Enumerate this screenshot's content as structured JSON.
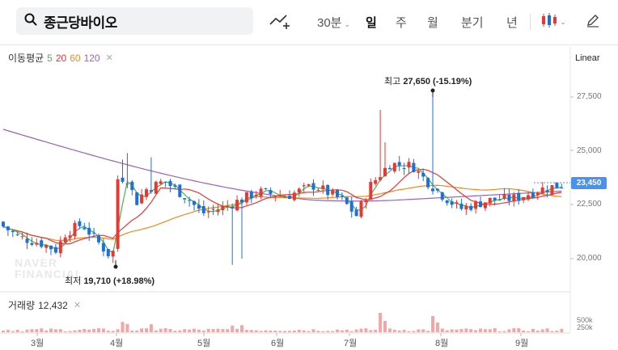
{
  "search": {
    "title": "종근당바이오"
  },
  "toolbar": {
    "interval_label": "30분",
    "periods": [
      "일",
      "주",
      "월",
      "분기",
      "년"
    ],
    "active_period": "일"
  },
  "ma_legend": {
    "label": "이동평균",
    "ma5": "5",
    "ma20": "20",
    "ma60": "60",
    "ma120": "120"
  },
  "scale_label": "Linear",
  "price_axis": [
    "27,500",
    "25,000",
    "22,500",
    "20,000"
  ],
  "current_price": "23,450",
  "high_annotation": {
    "label": "최고",
    "value": "27,650",
    "change": "(-15.19%)"
  },
  "low_annotation": {
    "label": "최저",
    "value": "19,710",
    "change": "(+18.98%)"
  },
  "watermark": [
    "NAVER",
    "FINANCIAL"
  ],
  "volume": {
    "label": "거래량",
    "value": "12,432",
    "axis": [
      "500k",
      "250k"
    ]
  },
  "months": [
    "3월",
    "4월",
    "5월",
    "6월",
    "7월",
    "8월",
    "9월"
  ],
  "colors": {
    "up": "#e53935",
    "down": "#1e6fd9",
    "ma5": "#4caf50",
    "ma20": "#e53935",
    "ma60": "#ef8a1c",
    "ma120": "#9b5fc0",
    "volume": "#f2a7a7"
  }
}
